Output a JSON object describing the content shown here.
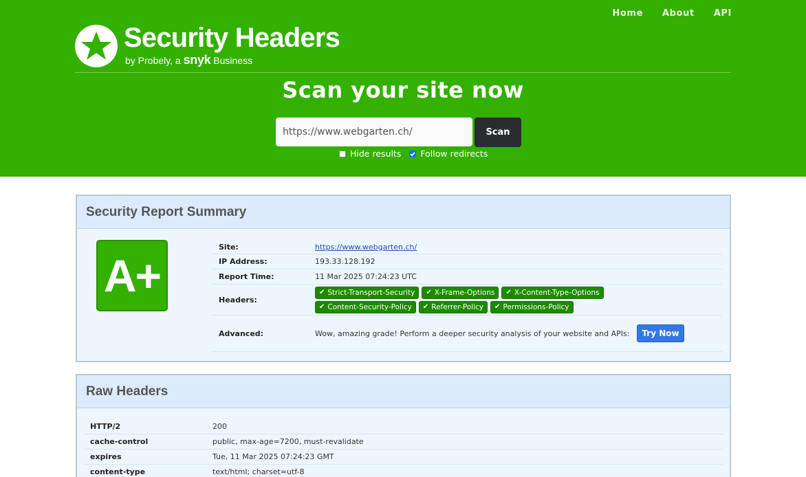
{
  "nav": {
    "items": [
      {
        "label": "Home"
      },
      {
        "label": "About"
      },
      {
        "label": "API"
      }
    ]
  },
  "logo": {
    "title": "Security Headers",
    "sub_prefix": "by Probely, a ",
    "sub_brand": "snyk",
    "sub_suffix": " Business",
    "icon": "star-icon"
  },
  "hero": {
    "title": "Scan your site now"
  },
  "search": {
    "value": "https://www.webgarten.ch/",
    "button_label": "Scan"
  },
  "options": [
    {
      "label": "Hide results",
      "checked": false
    },
    {
      "label": "Follow redirects",
      "checked": true
    }
  ],
  "summary": {
    "title": "Security Report Summary",
    "grade": "A+",
    "rows": {
      "site": {
        "label": "Site:",
        "value": "https://www.webgarten.ch/"
      },
      "ip": {
        "label": "IP Address:",
        "value": "193.33.128.192"
      },
      "time": {
        "label": "Report Time:",
        "value": "11 Mar 2025 07:24:23 UTC"
      },
      "headers": {
        "label": "Headers:"
      },
      "advanced": {
        "label": "Advanced:",
        "value": "Wow, amazing grade! Perform a deeper security analysis of your website and APIs:",
        "button_label": "Try Now"
      }
    },
    "headers": [
      "Strict-Transport-Security",
      "X-Frame-Options",
      "X-Content-Type-Options",
      "Content-Security-Policy",
      "Referrer-Policy",
      "Permissions-Policy"
    ]
  },
  "raw": {
    "title": "Raw Headers",
    "rows": [
      {
        "key": "HTTP/2",
        "value": "200"
      },
      {
        "key": "cache-control",
        "value": "public, max-age=7200, must-revalidate"
      },
      {
        "key": "expires",
        "value": "Tue, 11 Mar 2025 07:24:23 GMT"
      },
      {
        "key": "content-type",
        "value": "text/html; charset=utf-8"
      }
    ]
  },
  "colors": {
    "brand": "#33b000",
    "badge": "#1d8a00",
    "button_dark": "#2a2c2f",
    "try_button": "#3477e0"
  }
}
